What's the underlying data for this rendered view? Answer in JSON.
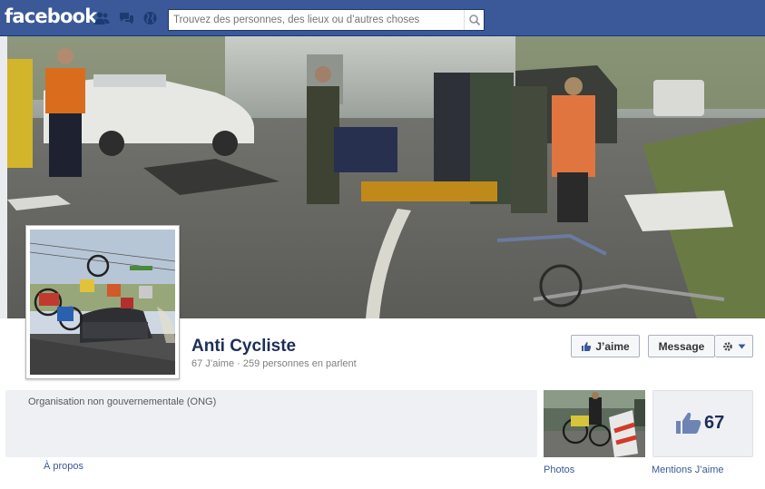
{
  "header": {
    "logo": "facebook",
    "search_placeholder": "Trouvez des personnes, des lieux ou d’autres choses"
  },
  "page": {
    "name": "Anti Cycliste",
    "likes_text": "67 J’aime",
    "separator": "·",
    "talking_text": "259 personnes en parlent",
    "category": "Organisation non gouvernementale (ONG)"
  },
  "actions": {
    "like_label": "J’aime",
    "message_label": "Message"
  },
  "apps": {
    "about_label": "À propos",
    "photos_label": "Photos",
    "likes_count": "67",
    "likes_label": "Mentions J’aime"
  },
  "colors": {
    "brand": "#3b5998",
    "link": "#3b5998",
    "name": "#1c2f57"
  },
  "icons": [
    "friend-requests-icon",
    "messages-icon",
    "notifications-globe-icon",
    "search-icon",
    "thumbs-up-icon",
    "gear-icon",
    "caret-down-icon"
  ]
}
